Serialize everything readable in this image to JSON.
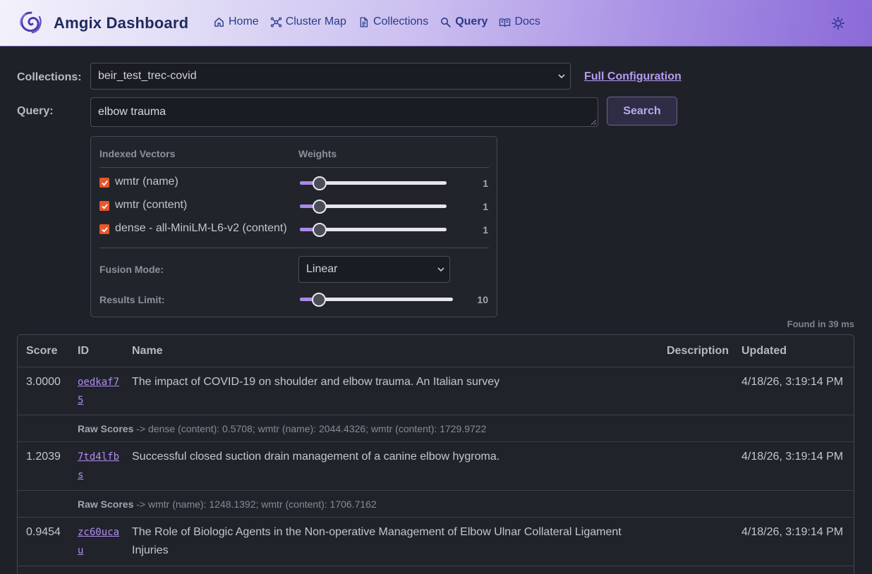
{
  "header": {
    "brand": "Amgix Dashboard",
    "nav": [
      {
        "label": "Home",
        "icon": "home-icon"
      },
      {
        "label": "Cluster Map",
        "icon": "cluster-icon"
      },
      {
        "label": "Collections",
        "icon": "document-icon"
      },
      {
        "label": "Query",
        "icon": "search-icon",
        "active": true
      },
      {
        "label": "Docs",
        "icon": "book-icon"
      }
    ],
    "theme_icon": "sun-icon"
  },
  "form": {
    "collections_label": "Collections:",
    "collection_value": "beir_test_trec-covid",
    "full_config_link": "Full Configuration",
    "query_label": "Query:",
    "query_value": "elbow trauma",
    "search_button": "Search"
  },
  "vectors": {
    "col_vectors": "Indexed Vectors",
    "col_weights": "Weights",
    "items": [
      {
        "name": "wmtr (name)",
        "checked": true,
        "weight": "1"
      },
      {
        "name": "wmtr (content)",
        "checked": true,
        "weight": "1"
      },
      {
        "name": "dense - all-MiniLM-L6-v2 (content)",
        "checked": true,
        "weight": "1"
      }
    ],
    "fusion_label": "Fusion Mode:",
    "fusion_value": "Linear",
    "limit_label": "Results Limit:",
    "limit_value": "10"
  },
  "results": {
    "found_text": "Found in 39 ms",
    "columns": {
      "score": "Score",
      "id": "ID",
      "name": "Name",
      "description": "Description",
      "updated": "Updated"
    },
    "raw_label": "Raw Scores",
    "rows": [
      {
        "score": "3.0000",
        "id": "oedkaf75",
        "name": "The impact of COVID-19 on shoulder and elbow trauma. An Italian survey",
        "updated": "4/18/26, 3:19:14 PM",
        "raw": " -> dense (content): 0.5708; wmtr (name): 2044.4326; wmtr (content): 1729.9722"
      },
      {
        "score": "1.2039",
        "id": "7td4lfbs",
        "name": "Successful closed suction drain management of a canine elbow hygroma.",
        "updated": "4/18/26, 3:19:14 PM",
        "raw": " -> wmtr (name): 1248.1392; wmtr (content): 1706.7162"
      },
      {
        "score": "0.9454",
        "id": "zc60ucau",
        "name": "The Role of Biologic Agents in the Non-operative Management of Elbow Ulnar Collateral Ligament Injuries",
        "updated": "4/18/26, 3:19:14 PM"
      }
    ]
  }
}
